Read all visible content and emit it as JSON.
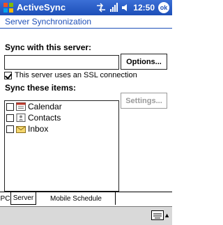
{
  "titlebar": {
    "app_title": "ActiveSync",
    "time": "12:50",
    "ok_label": "ok"
  },
  "header": {
    "title": "Server Synchronization"
  },
  "form": {
    "sync_with_label": "Sync with this server:",
    "server_value": "",
    "options_label": "Options...",
    "ssl_label": "This server uses an SSL connection",
    "ssl_checked": true,
    "sync_items_label": "Sync these items:",
    "settings_label": "Settings...",
    "items": [
      {
        "label": "Calendar",
        "icon": "calendar-icon",
        "checked": false
      },
      {
        "label": "Contacts",
        "icon": "contacts-icon",
        "checked": false
      },
      {
        "label": "Inbox",
        "icon": "inbox-icon",
        "checked": false
      }
    ]
  },
  "tabs": [
    {
      "label": "PC",
      "active": false
    },
    {
      "label": "Server",
      "active": true
    },
    {
      "label": "Mobile Schedule",
      "active": false
    }
  ],
  "menubar": {
    "input_icon": "keyboard-icon"
  },
  "colors": {
    "title_bar": "#1d4fb8",
    "header_text": "#1d4fb8"
  }
}
